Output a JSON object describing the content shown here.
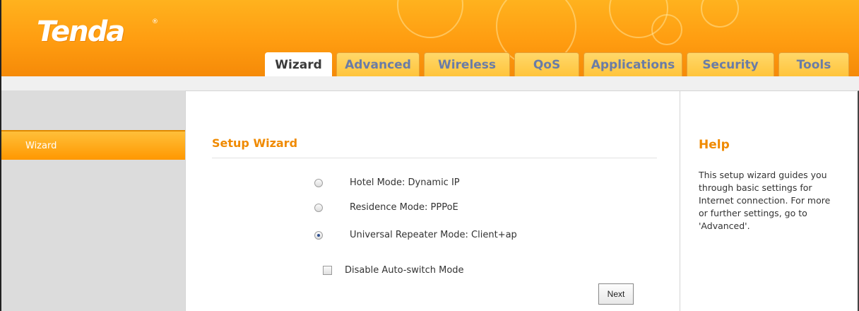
{
  "brand": {
    "logo_text": "Tenda",
    "registered_mark": "®"
  },
  "tabs": [
    {
      "label": "Wizard",
      "active": true
    },
    {
      "label": "Advanced",
      "active": false
    },
    {
      "label": "Wireless",
      "active": false
    },
    {
      "label": "QoS",
      "active": false
    },
    {
      "label": "Applications",
      "active": false
    },
    {
      "label": "Security",
      "active": false
    },
    {
      "label": "Tools",
      "active": false
    }
  ],
  "sidebar": {
    "items": [
      {
        "label": "Wizard",
        "active": true
      }
    ]
  },
  "main": {
    "title": "Setup Wizard",
    "options": [
      {
        "label": "Hotel Mode:  Dynamic IP",
        "checked": false
      },
      {
        "label": "Residence Mode:  PPPoE",
        "checked": false
      },
      {
        "label": "Universal Repeater Mode:  Client+ap",
        "checked": true
      }
    ],
    "disable_auto_switch": {
      "label": "Disable Auto-switch Mode",
      "checked": false
    },
    "next_label": "Next"
  },
  "help": {
    "title": "Help",
    "text": "This setup wizard guides you through basic settings for Internet connection. For more or further settings, go to 'Advanced'."
  },
  "colors": {
    "header_orange": "#ff9c10",
    "accent": "#f08a00",
    "tab_text": "#6a7ca6"
  }
}
